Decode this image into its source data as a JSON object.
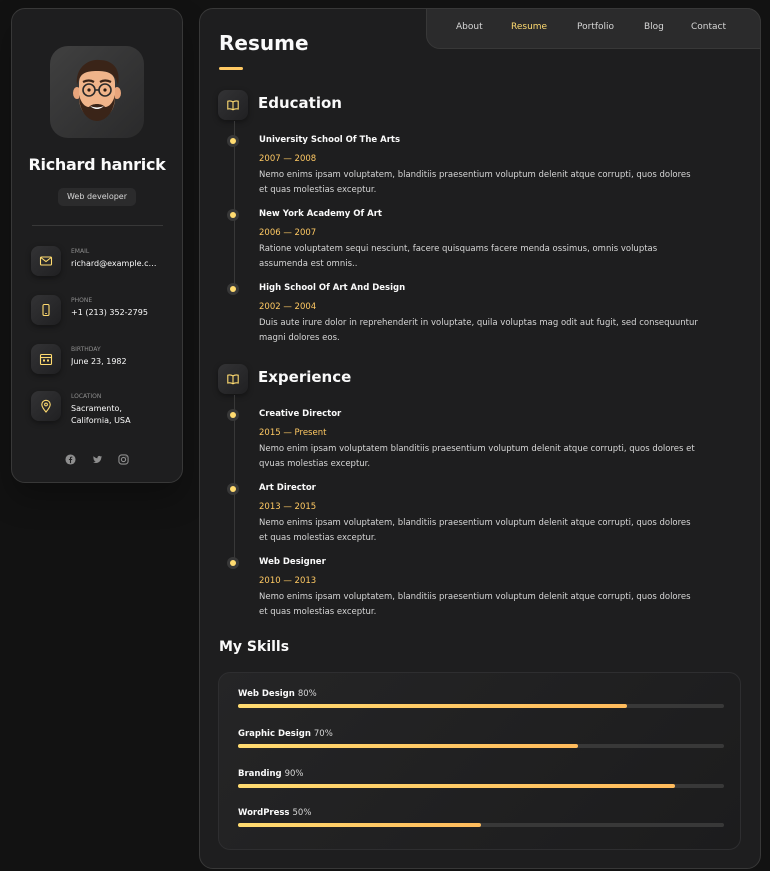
{
  "profile": {
    "name": "Richard hanrick",
    "role": "Web developer"
  },
  "contacts": [
    {
      "label": "Email",
      "value": "richard@example.com",
      "icon": "mail-icon"
    },
    {
      "label": "Phone",
      "value": "+1 (213) 352-2795",
      "icon": "phone-icon"
    },
    {
      "label": "Birthday",
      "value": "June 23, 1982",
      "icon": "calendar-icon"
    },
    {
      "label": "Location",
      "value": "Sacramento, California, USA",
      "icon": "location-pin-icon"
    }
  ],
  "socials": [
    "facebook-icon",
    "twitter-icon",
    "instagram-icon"
  ],
  "nav": {
    "items": [
      "About",
      "Resume",
      "Portfolio",
      "Blog",
      "Contact"
    ],
    "active": "Resume"
  },
  "page": {
    "title": "Resume"
  },
  "education": {
    "title": "Education",
    "items": [
      {
        "name": "University School Of The Arts",
        "date": "2007 — 2008",
        "text": "Nemo enims ipsam voluptatem, blanditiis praesentium voluptum delenit atque corrupti, quos dolores et quas molestias exceptur."
      },
      {
        "name": "New York Academy Of Art",
        "date": "2006 — 2007",
        "text": "Ratione voluptatem sequi nesciunt, facere quisquams facere menda ossimus, omnis voluptas assumenda est omnis.."
      },
      {
        "name": "High School Of Art And Design",
        "date": "2002 — 2004",
        "text": "Duis aute irure dolor in reprehenderit in voluptate, quila voluptas mag odit aut fugit, sed consequuntur magni dolores eos."
      }
    ]
  },
  "experience": {
    "title": "Experience",
    "items": [
      {
        "name": "Creative Director",
        "date": "2015 — Present",
        "text": "Nemo enim ipsam voluptatem blanditiis praesentium voluptum delenit atque corrupti, quos dolores et qvuas molestias exceptur."
      },
      {
        "name": "Art Director",
        "date": "2013 — 2015",
        "text": "Nemo enims ipsam voluptatem, blanditiis praesentium voluptum delenit atque corrupti, quos dolores et quas molestias exceptur."
      },
      {
        "name": "Web Designer",
        "date": "2010 — 2013",
        "text": "Nemo enims ipsam voluptatem, blanditiis praesentium voluptum delenit atque corrupti, quos dolores et quas molestias exceptur."
      }
    ]
  },
  "skills": {
    "title": "My Skills",
    "items": [
      {
        "name": "Web Design",
        "label": "80%",
        "percent": 80
      },
      {
        "name": "Graphic Design",
        "label": "70%",
        "percent": 70
      },
      {
        "name": "Branding",
        "label": "90%",
        "percent": 90
      },
      {
        "name": "WordPress",
        "label": "50%",
        "percent": 50
      }
    ]
  },
  "colors": {
    "accent": "#ffdb70",
    "background": "#121212",
    "panel": "#1e1e1f"
  }
}
